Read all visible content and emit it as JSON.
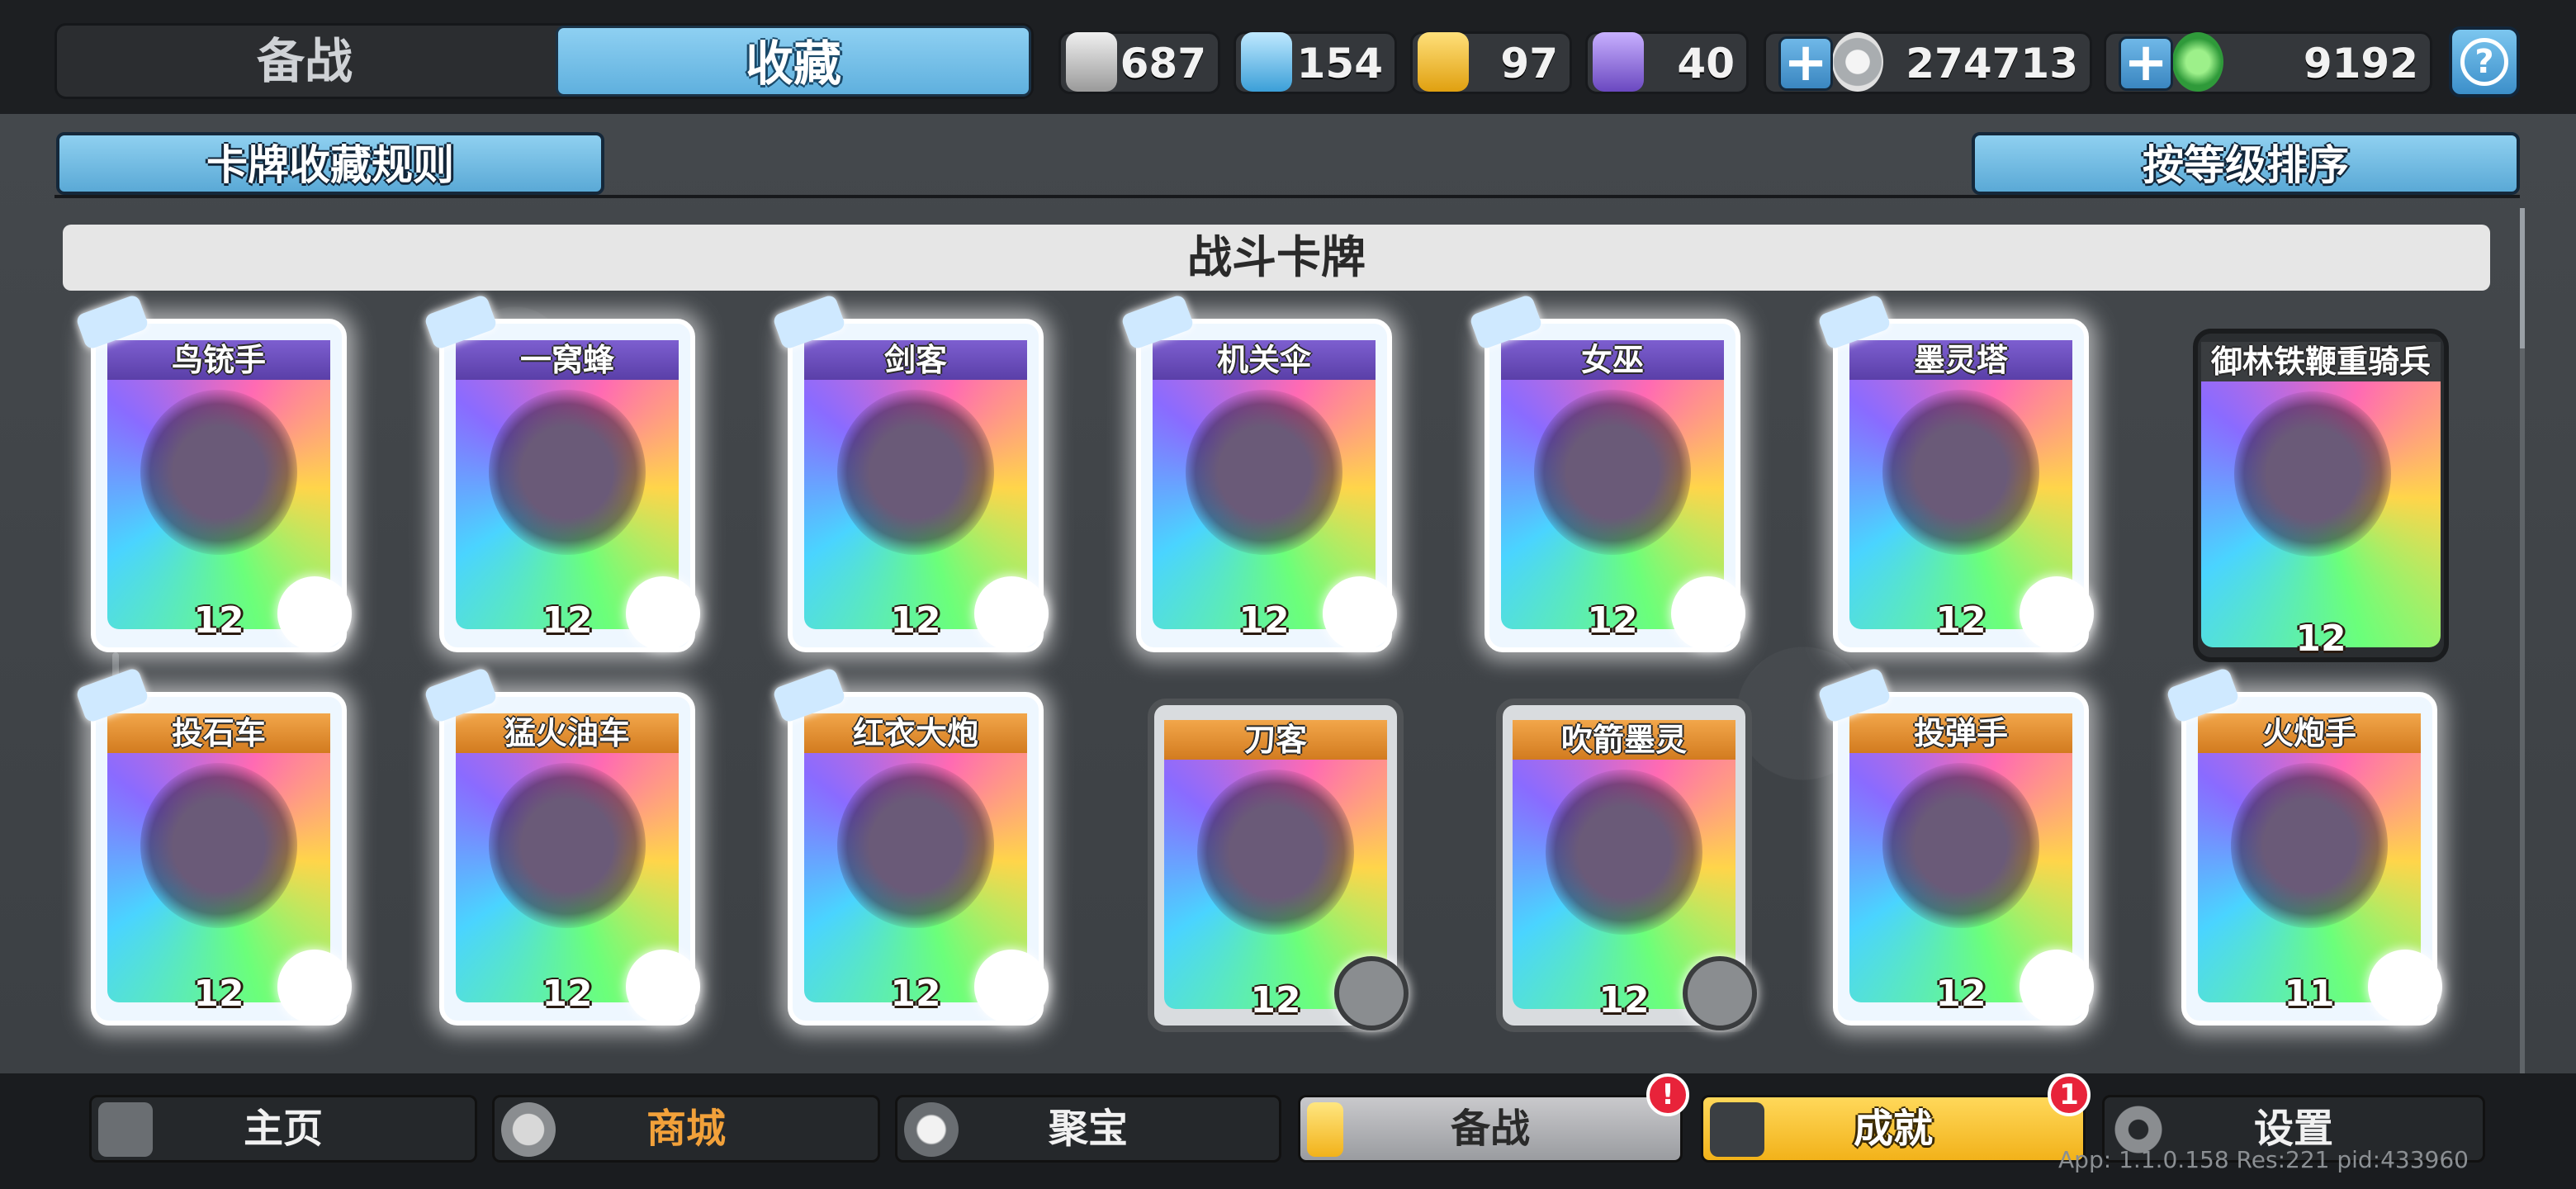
{
  "tabs": {
    "prepare": "备战",
    "collection": "收藏"
  },
  "resources": [
    {
      "icon": "silver-shield-icon",
      "value": "687",
      "color": "#c9c9c9"
    },
    {
      "icon": "blue-crystal-icon",
      "value": "154",
      "color": "#6fc3ef"
    },
    {
      "icon": "gold-shield-icon",
      "value": "97",
      "color": "#f2b21a"
    },
    {
      "icon": "purple-crystal-icon",
      "value": "40",
      "color": "#8a6bd0"
    },
    {
      "icon": "silver-coin-icon",
      "value": "274713",
      "color": "#d0d3d6"
    },
    {
      "icon": "green-gem-icon",
      "value": "9192",
      "color": "#4fbf5a"
    }
  ],
  "subheader": {
    "rules_button": "卡牌收藏规则",
    "sort_button": "按等级排序"
  },
  "section_title": "战斗卡牌",
  "cards": [
    {
      "name": "鸟铳手",
      "level": "12",
      "style": "purple"
    },
    {
      "name": "一窝蜂",
      "level": "12",
      "style": "purple"
    },
    {
      "name": "剑客",
      "level": "12",
      "style": "purple"
    },
    {
      "name": "机关伞",
      "level": "12",
      "style": "purple"
    },
    {
      "name": "女巫",
      "level": "12",
      "style": "purple"
    },
    {
      "name": "墨灵塔",
      "level": "12",
      "style": "purple"
    },
    {
      "name": "御林铁鞭重骑兵",
      "level": "12",
      "style": "dark"
    },
    {
      "name": "投石车",
      "level": "12",
      "style": "orange"
    },
    {
      "name": "猛火油车",
      "level": "12",
      "style": "orange"
    },
    {
      "name": "红衣大炮",
      "level": "12",
      "style": "orange"
    },
    {
      "name": "刀客",
      "level": "12",
      "style": "orange gold"
    },
    {
      "name": "吹箭墨灵",
      "level": "12",
      "style": "orange gold"
    },
    {
      "name": "投弹手",
      "level": "12",
      "style": "orange"
    },
    {
      "name": "火炮手",
      "level": "11",
      "style": "orange"
    }
  ],
  "nav": [
    {
      "label": "主页",
      "icon": "home-icon"
    },
    {
      "label": "商城",
      "icon": "coins-icon"
    },
    {
      "label": "聚宝",
      "icon": "treasure-bowl-icon"
    },
    {
      "label": "备战",
      "icon": "cards-icon",
      "badge": "!"
    },
    {
      "label": "成就",
      "icon": "achievement-icon",
      "badge": "1"
    },
    {
      "label": "设置",
      "icon": "gear-icon"
    }
  ],
  "version": "App: 1.1.0.158 Res:221 pid:433960"
}
